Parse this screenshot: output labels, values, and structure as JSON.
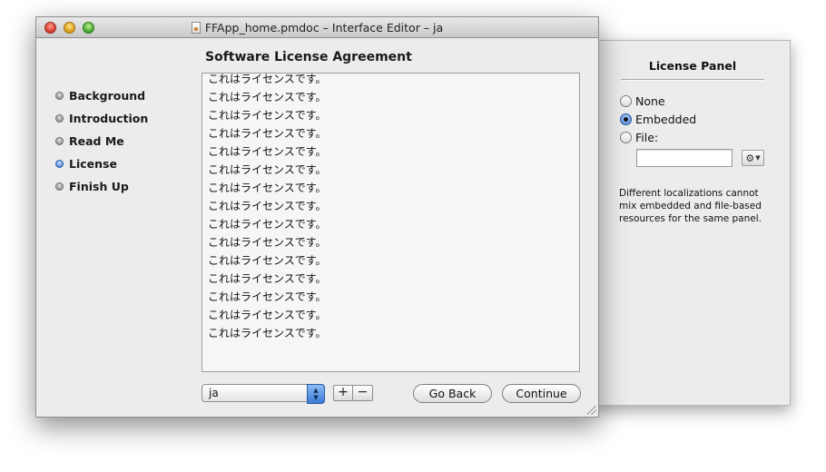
{
  "inspector": {
    "title": "License Panel",
    "options": [
      {
        "label": "None",
        "selected": false
      },
      {
        "label": "Embedded",
        "selected": true
      },
      {
        "label": "File:",
        "selected": false
      }
    ],
    "file_value": "",
    "gear_icon": "gear-icon",
    "note": "Different localizations cannot\nmix embedded and file-based\nresources for the same panel."
  },
  "window": {
    "title": "FFApp_home.pmdoc – Interface Editor – ja",
    "steps": [
      {
        "label": "Background",
        "active": false
      },
      {
        "label": "Introduction",
        "active": false
      },
      {
        "label": "Read Me",
        "active": false
      },
      {
        "label": "License",
        "active": true
      },
      {
        "label": "Finish Up",
        "active": false
      }
    ],
    "content_title": "Software License Agreement",
    "license_lines": [
      "これはライセンスです。",
      "これはライセンスです。",
      "これはライセンスです。",
      "これはライセンスです。",
      "これはライセンスです。",
      "これはライセンスです。",
      "これはライセンスです。",
      "これはライセンスです。",
      "これはライセンスです。",
      "これはライセンスです。",
      "これはライセンスです。",
      "これはライセンスです。",
      "これはライセンスです。",
      "これはライセンスです。",
      "これはライセンスです。"
    ],
    "language": "ja",
    "add_label": "+",
    "remove_label": "−",
    "back_label": "Go Back",
    "continue_label": "Continue"
  },
  "colors": {
    "active_bullet": "#3e7fd9",
    "window_bg": "#ececec"
  }
}
